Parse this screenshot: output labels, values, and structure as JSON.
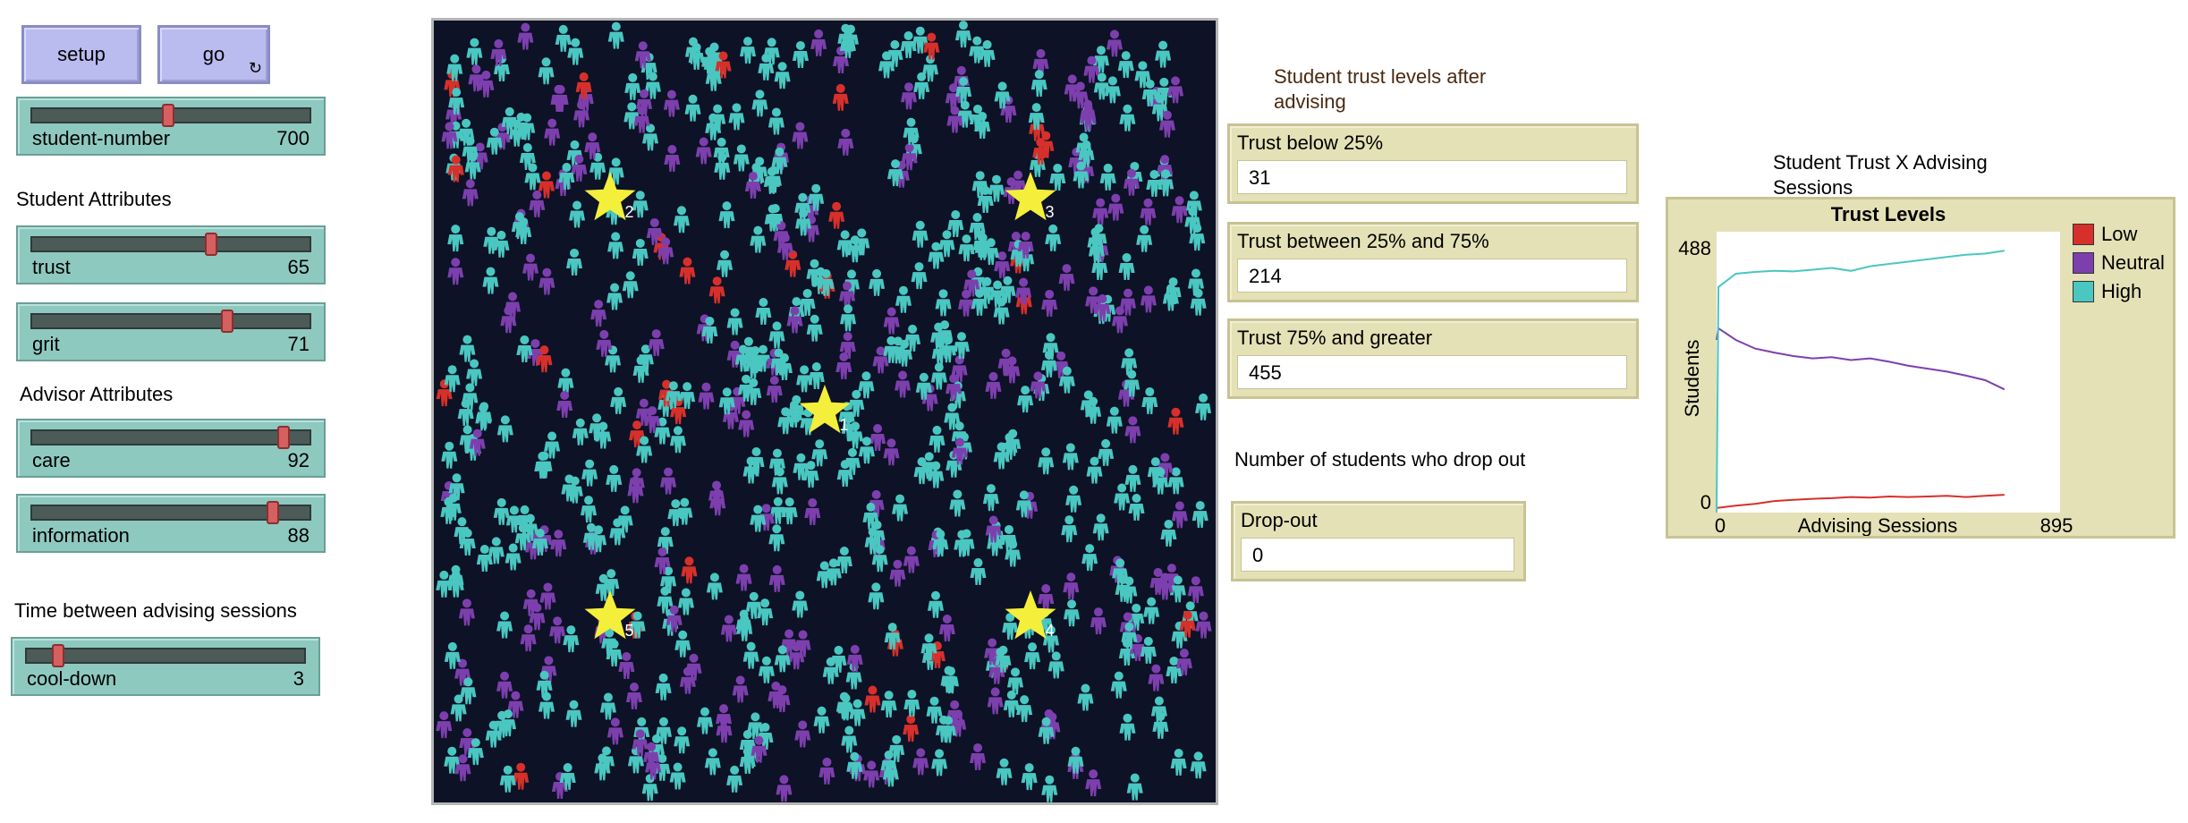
{
  "buttons": {
    "setup": "setup",
    "go": "go",
    "go_forever_icon": "↻"
  },
  "sliders": [
    {
      "name": "student-number",
      "label": "student-number",
      "value": "700",
      "fraction": 0.49
    },
    {
      "name": "trust",
      "label": "trust",
      "value": "65",
      "fraction": 0.65
    },
    {
      "name": "grit",
      "label": "grit",
      "value": "71",
      "fraction": 0.71
    },
    {
      "name": "care",
      "label": "care",
      "value": "92",
      "fraction": 0.92
    },
    {
      "name": "information",
      "label": "information",
      "value": "88",
      "fraction": 0.88
    },
    {
      "name": "cool-down",
      "label": "cool-down",
      "value": "3",
      "fraction": 0.1
    }
  ],
  "notes": {
    "student_attributes": "Student Attributes",
    "advisor_attributes": "Advisor Attributes",
    "time_between": "Time between advising sessions",
    "trust_after": "Student trust levels after advising",
    "dropout_note": "Number of students who drop out",
    "plot_note": "Student Trust X Advising Sessions"
  },
  "monitors": [
    {
      "label": "Trust below 25%",
      "value": "31"
    },
    {
      "label": "Trust between 25% and 75%",
      "value": "214"
    },
    {
      "label": "Trust 75% and greater",
      "value": "455"
    },
    {
      "label": "Drop-out",
      "value": "0"
    }
  ],
  "world": {
    "background": "#0d1226",
    "advisors": [
      {
        "id": "1",
        "color": "#f3ef3a"
      },
      {
        "id": "2",
        "color": "#f3ef3a"
      },
      {
        "id": "3",
        "color": "#f3ef3a"
      },
      {
        "id": "4",
        "color": "#f3ef3a"
      },
      {
        "id": "5",
        "color": "#f3ef3a"
      }
    ],
    "student_colors": {
      "high": "#4ac7c1",
      "neutral": "#7d3fae",
      "low": "#d7302b"
    }
  },
  "chart_data": {
    "type": "line",
    "title": "Trust Levels",
    "xlabel": "Advising Sessions",
    "ylabel": "Students",
    "xlim": [
      0,
      895
    ],
    "ylim": [
      0,
      488
    ],
    "x_tick_labels": [
      "0",
      "895"
    ],
    "y_tick_labels": [
      "0",
      "488"
    ],
    "legend_placement": "right",
    "series": [
      {
        "name": "Low",
        "color": "#d7302b",
        "x": [
          0,
          50,
          100,
          150,
          200,
          250,
          300,
          350,
          400,
          450,
          500,
          550,
          600,
          650,
          700,
          750
        ],
        "y": [
          8,
          12,
          15,
          20,
          22,
          24,
          25,
          27,
          26,
          28,
          27,
          28,
          29,
          27,
          29,
          31
        ]
      },
      {
        "name": "Neutral",
        "color": "#7d3fae",
        "x": [
          0,
          5,
          50,
          100,
          150,
          200,
          250,
          300,
          350,
          400,
          450,
          500,
          550,
          600,
          650,
          700,
          750
        ],
        "y": [
          300,
          320,
          300,
          285,
          278,
          272,
          268,
          270,
          265,
          268,
          262,
          255,
          250,
          245,
          238,
          230,
          214
        ]
      },
      {
        "name": "High",
        "color": "#4ac7c1",
        "x": [
          0,
          5,
          50,
          100,
          150,
          200,
          250,
          300,
          350,
          400,
          450,
          500,
          550,
          600,
          650,
          700,
          750
        ],
        "y": [
          0,
          392,
          415,
          418,
          420,
          419,
          422,
          425,
          420,
          428,
          432,
          436,
          440,
          444,
          448,
          450,
          455
        ]
      }
    ]
  }
}
